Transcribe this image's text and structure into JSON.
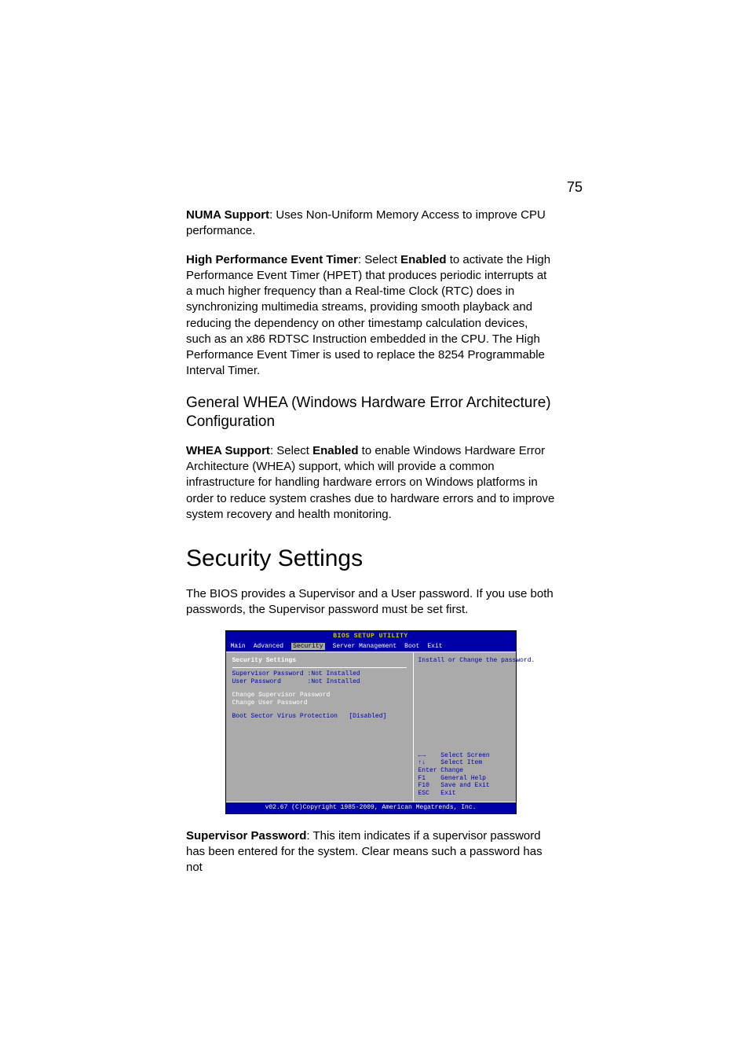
{
  "page_number": "75",
  "para1": {
    "boldLead": "NUMA Support",
    "rest": ": Uses Non-Uniform Memory Access to improve CPU performance."
  },
  "para2": {
    "bold1": "High Performance Event Timer",
    "seg1": ": Select ",
    "bold2": "Enabled",
    "seg2": " to activate the High Performance Event Timer (HPET) that produces periodic interrupts at a much higher frequency than a Real-time Clock (RTC) does in synchronizing multimedia streams, providing smooth playback and reducing the dependency on other timestamp calculation devices, such as an x86 RDTSC Instruction embedded in the CPU. The High Performance Event Timer is used to replace the 8254 Programmable Interval Timer."
  },
  "h2": "General WHEA (Windows Hardware Error Architecture) Configuration",
  "para3": {
    "bold1": "WHEA Support",
    "seg1": ": Select ",
    "bold2": "Enabled",
    "seg2": " to enable Windows Hardware Error Architecture (WHEA) support, which will provide a common infrastructure for handling hardware errors on Windows platforms in order to reduce system crashes due to hardware errors and to improve system recovery and health monitoring."
  },
  "h1": "Security Settings",
  "intro": "The BIOS provides a Supervisor and a User password. If you use both passwords, the Supervisor password must be set first.",
  "bios": {
    "title": "BIOS SETUP UTILITY",
    "tabs": [
      "Main",
      "Advanced",
      "Security",
      "Server Management",
      "Boot",
      "Exit"
    ],
    "selectedTab": "Security",
    "panelHeading": "Security Settings",
    "line_sup": "Supervisor Password :Not Installed",
    "line_usr": "User Password       :Not Installed",
    "line_csp": "Change Supervisor Password",
    "line_cup": "Change User Password",
    "line_bsv": "Boot Sector Virus Protection   [Disabled]",
    "helpTop": "Install or Change the password.",
    "help1": "←→    Select Screen",
    "help2": "↑↓    Select Item",
    "help3": "Enter Change",
    "help4": "F1    General Help",
    "help5": "F10   Save and Exit",
    "help6": "ESC   Exit",
    "footer": "v02.67 (C)Copyright 1985-2009, American Megatrends, Inc."
  },
  "para4": {
    "bold1": "Supervisor Password",
    "rest": ": This item indicates if a supervisor password has been entered for the system. Clear means such a password has not"
  }
}
